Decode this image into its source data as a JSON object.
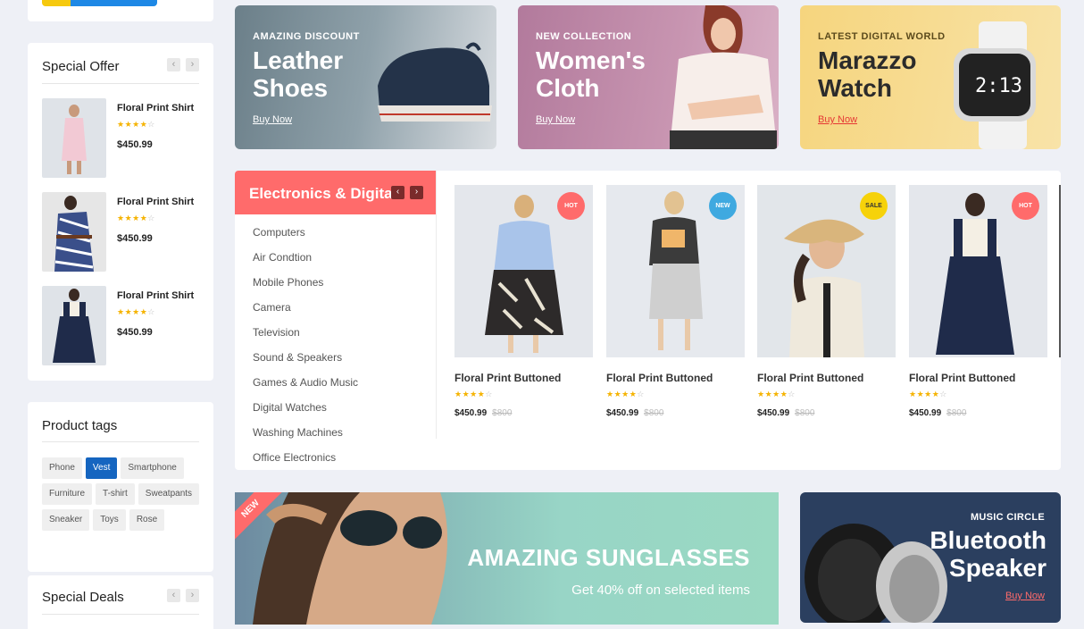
{
  "special_offer": {
    "title": "Special Offer",
    "prev": "‹",
    "next": "›",
    "items": [
      {
        "name": "Floral Print Shirt",
        "price": "$450.99"
      },
      {
        "name": "Floral Print Shirt",
        "price": "$450.99"
      },
      {
        "name": "Floral Print Shirt",
        "price": "$450.99"
      }
    ],
    "rating": 4
  },
  "product_tags": {
    "title": "Product tags",
    "tags": [
      "Phone",
      "Vest",
      "Smartphone",
      "Furniture",
      "T-shirt",
      "Sweatpants",
      "Sneaker",
      "Toys",
      "Rose"
    ],
    "active_tag": "Vest"
  },
  "special_deals": {
    "title": "Special Deals",
    "prev": "‹",
    "next": "›"
  },
  "banners": {
    "shoes": {
      "eyebrow": "AMAZING DISCOUNT",
      "title": "Leather Shoes",
      "link": "Buy Now"
    },
    "cloth": {
      "eyebrow": "NEW COLLECTION",
      "title": "Women's Cloth",
      "link": "Buy Now"
    },
    "watch": {
      "eyebrow": "LATEST DIGITAL WORLD",
      "title": "Marazzo Watch",
      "link": "Buy Now",
      "display": "2:13"
    },
    "sunglasses": {
      "ribbon": "NEW",
      "title": "AMAZING SUNGLASSES",
      "subtitle": "Get 40% off on selected items"
    },
    "speaker": {
      "eyebrow": "MUSIC CIRCLE",
      "title_line1": "Bluetooth",
      "title_line2": "Speaker",
      "link": "Buy Now"
    }
  },
  "category": {
    "title": "Electronics & Digital",
    "prev": "‹",
    "next": "›",
    "items": [
      "Computers",
      "Air Condtion",
      "Mobile Phones",
      "Camera",
      "Television",
      "Sound & Speakers",
      "Games & Audio Music",
      "Digital Watches",
      "Washing Machines",
      "Office Electronics"
    ]
  },
  "products": [
    {
      "name": "Floral Print Buttoned",
      "price": "$450.99",
      "old_price": "$800",
      "badge": "HOT",
      "badge_color": "#ff6b6b",
      "rating": 4
    },
    {
      "name": "Floral Print Buttoned",
      "price": "$450.99",
      "old_price": "$800",
      "badge": "NEW",
      "badge_color": "#3fa9e0",
      "rating": 4
    },
    {
      "name": "Floral Print Buttoned",
      "price": "$450.99",
      "old_price": "$800",
      "badge": "SALE",
      "badge_color": "#f6d20a",
      "rating": 4
    },
    {
      "name": "Floral Print Buttoned",
      "price": "$450.99",
      "old_price": "$800",
      "badge": "HOT",
      "badge_color": "#ff6b6b",
      "rating": 4
    }
  ],
  "colors": {
    "accent": "#ff6b6b",
    "tag_active": "#1565c0",
    "star": "#f5b301"
  }
}
